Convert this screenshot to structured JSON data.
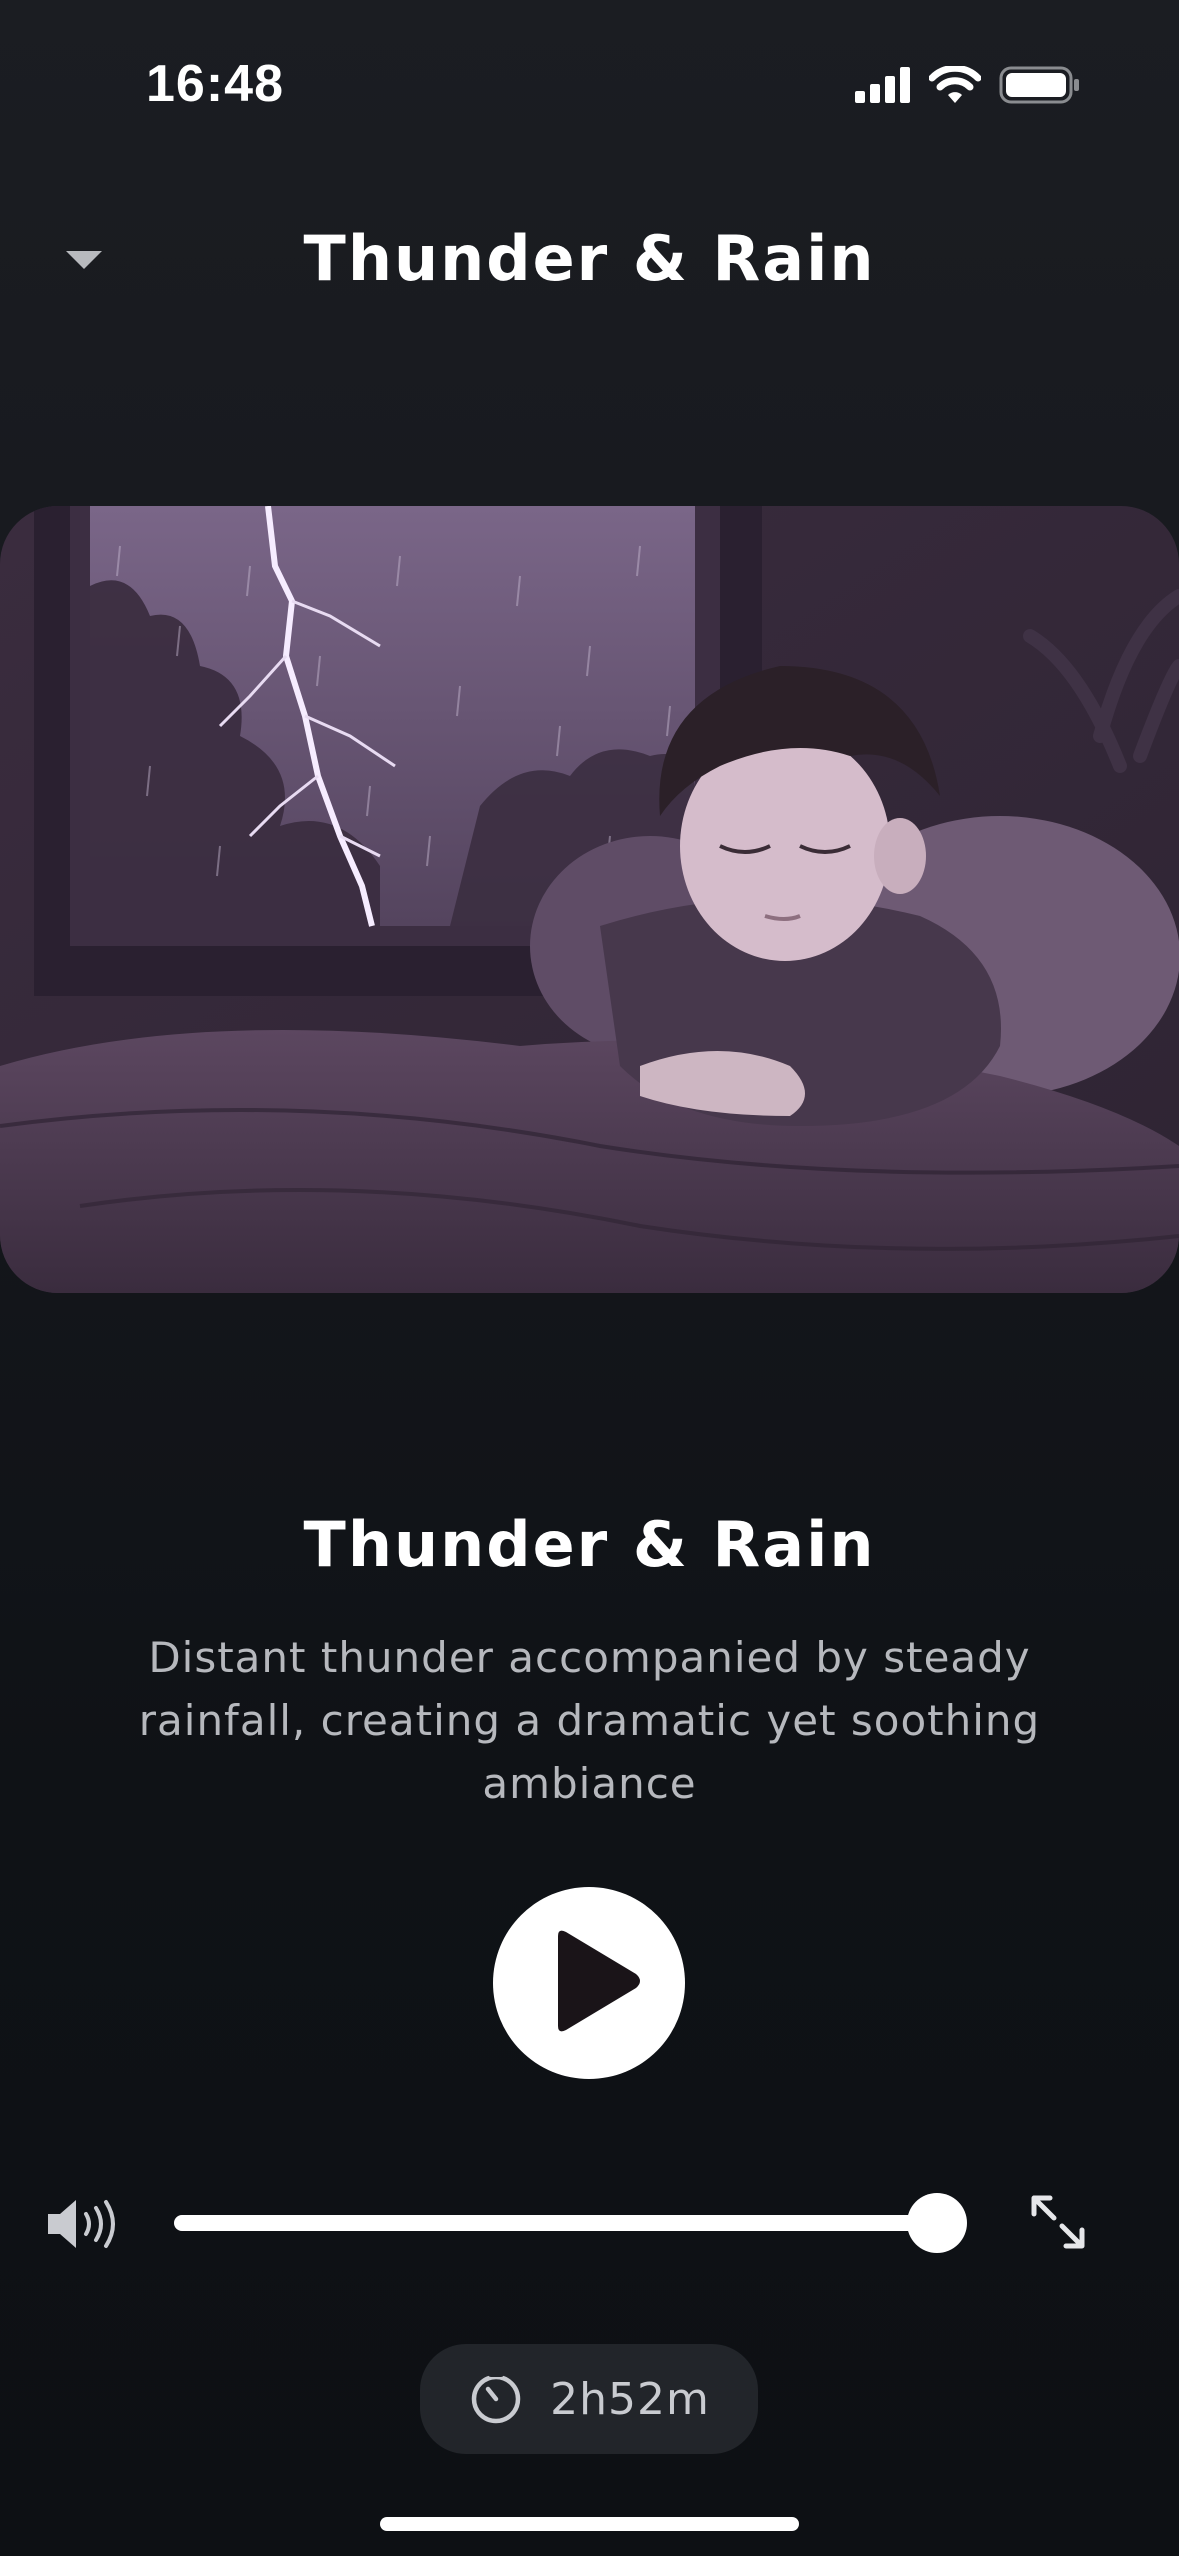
{
  "status_bar": {
    "time": "16:48"
  },
  "header": {
    "title": "Thunder & Rain",
    "collapse_icon": "chevron-down-icon"
  },
  "artwork": {
    "description_icon": "sleeping-boy-thunderstorm-illustration"
  },
  "track": {
    "title": "Thunder & Rain",
    "description": "Distant thunder accompanied by steady rainfall, creating a dramatic yet soothing ambiance"
  },
  "player": {
    "state": "paused",
    "play_icon": "play-icon"
  },
  "volume": {
    "level": 0.97,
    "icon": "speaker-icon"
  },
  "expand": {
    "icon": "expand-icon"
  },
  "timer": {
    "label": "2h52m",
    "icon": "timer-icon"
  },
  "colors": {
    "background": "#15171c",
    "accent": "#ffffff",
    "muted_text": "#b6b8bd",
    "pill": "#22252a"
  }
}
